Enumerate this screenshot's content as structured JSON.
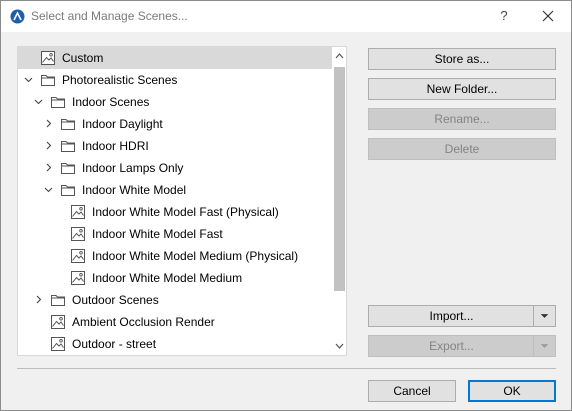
{
  "window": {
    "title": "Select and Manage Scenes...",
    "help_label": "?"
  },
  "tree": {
    "rows": [
      {
        "label": "Custom",
        "icon": "scene-icon",
        "expander": "none",
        "depth": 0,
        "selected": true
      },
      {
        "label": "Photorealistic Scenes",
        "icon": "folder-icon",
        "expander": "expanded",
        "depth": 0
      },
      {
        "label": "Indoor Scenes",
        "icon": "folder-icon",
        "expander": "expanded",
        "depth": 1
      },
      {
        "label": "Indoor Daylight",
        "icon": "folder-icon",
        "expander": "collapsed",
        "depth": 2
      },
      {
        "label": "Indoor HDRI",
        "icon": "folder-icon",
        "expander": "collapsed",
        "depth": 2
      },
      {
        "label": "Indoor Lamps Only",
        "icon": "folder-icon",
        "expander": "collapsed",
        "depth": 2
      },
      {
        "label": "Indoor White Model",
        "icon": "folder-icon",
        "expander": "expanded",
        "depth": 2
      },
      {
        "label": "Indoor White Model Fast (Physical)",
        "icon": "scene-icon",
        "expander": "none",
        "depth": 3
      },
      {
        "label": "Indoor White Model Fast",
        "icon": "scene-icon",
        "expander": "none",
        "depth": 3
      },
      {
        "label": "Indoor White Model Medium (Physical)",
        "icon": "scene-icon",
        "expander": "none",
        "depth": 3
      },
      {
        "label": "Indoor White Model Medium",
        "icon": "scene-icon",
        "expander": "none",
        "depth": 3
      },
      {
        "label": "Outdoor Scenes",
        "icon": "folder-icon",
        "expander": "collapsed",
        "depth": 1
      },
      {
        "label": "Ambient Occlusion Render",
        "icon": "scene-icon",
        "expander": "none",
        "depth": 1
      },
      {
        "label": "Outdoor - street",
        "icon": "scene-icon",
        "expander": "none",
        "depth": 1
      }
    ]
  },
  "buttons": {
    "store_as": {
      "label": "Store as...",
      "enabled": true
    },
    "new_folder": {
      "label": "New Folder...",
      "enabled": true
    },
    "rename": {
      "label": "Rename...",
      "enabled": false
    },
    "delete": {
      "label": "Delete",
      "enabled": false
    },
    "import": {
      "label": "Import...",
      "enabled": true
    },
    "export": {
      "label": "Export...",
      "enabled": false
    },
    "cancel": {
      "label": "Cancel",
      "enabled": true
    },
    "ok": {
      "label": "OK",
      "enabled": true,
      "default": true
    }
  },
  "colors": {
    "selection": "#d9d9d9",
    "default_button_border": "#0078d7",
    "disabled_button": "#cccccc",
    "app_icon": "#1f5fa8"
  }
}
